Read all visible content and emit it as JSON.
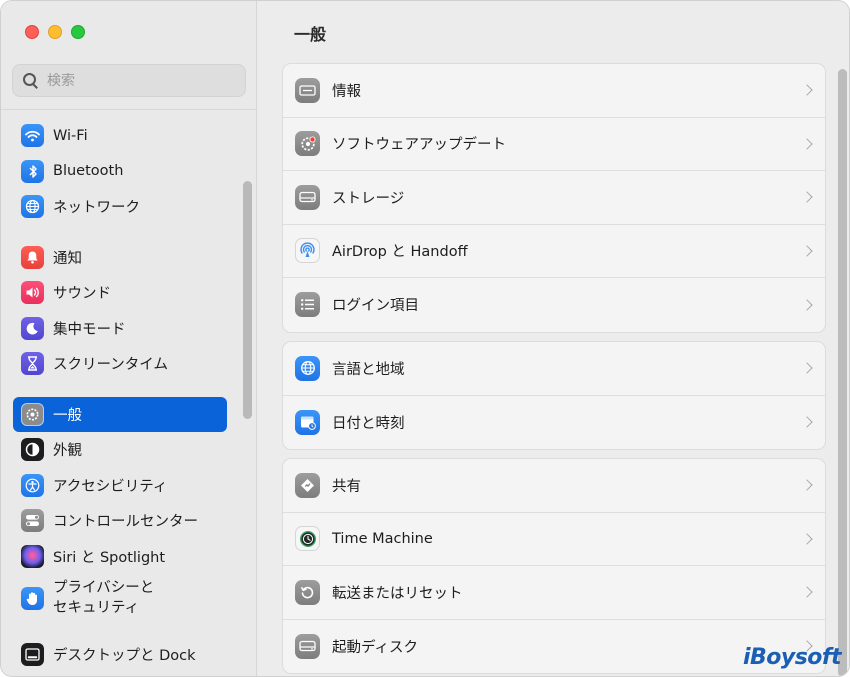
{
  "window": {
    "title": "一般"
  },
  "sidebar": {
    "search_placeholder": "検索",
    "items": [
      {
        "label": "Wi-Fi",
        "icon": "wifi-icon",
        "color": "#1f7cf0"
      },
      {
        "label": "Bluetooth",
        "icon": "bluetooth-icon",
        "color": "#1f7cf0"
      },
      {
        "label": "ネットワーク",
        "icon": "globe-icon",
        "color": "#1f7cf0"
      },
      {
        "label": "通知",
        "icon": "bell-icon",
        "color": "#f24a43"
      },
      {
        "label": "サウンド",
        "icon": "speaker-icon",
        "color": "#f0365f"
      },
      {
        "label": "集中モード",
        "icon": "moon-icon",
        "color": "#5a4fd9"
      },
      {
        "label": "スクリーンタイム",
        "icon": "hourglass-icon",
        "color": "#5a4fd9"
      },
      {
        "label": "一般",
        "icon": "gear-icon",
        "color": "#8c8c8c",
        "selected": true
      },
      {
        "label": "外観",
        "icon": "appearance-icon",
        "color": "#1d1d1f"
      },
      {
        "label": "アクセシビリティ",
        "icon": "accessibility-icon",
        "color": "#1f7cf0"
      },
      {
        "label": "コントロールセンター",
        "icon": "control-center-icon",
        "color": "#8c8c8c"
      },
      {
        "label": "Siri と Spotlight",
        "icon": "siri-icon",
        "color": "#6c5ff2"
      },
      {
        "label": "プライバシーと\nセキュリティ",
        "icon": "hand-icon",
        "color": "#1f7cf0"
      },
      {
        "label": "デスクトップと Dock",
        "icon": "dock-icon",
        "color": "#1d1d1f"
      }
    ]
  },
  "main": {
    "title": "一般",
    "groups": [
      [
        {
          "label": "情報",
          "icon": "info-icon"
        },
        {
          "label": "ソフトウェアアップデート",
          "icon": "software-update-icon"
        },
        {
          "label": "ストレージ",
          "icon": "storage-icon"
        },
        {
          "label": "AirDrop と Handoff",
          "icon": "airdrop-icon"
        },
        {
          "label": "ログイン項目",
          "icon": "login-items-icon"
        }
      ],
      [
        {
          "label": "言語と地域",
          "icon": "language-globe-icon"
        },
        {
          "label": "日付と時刻",
          "icon": "calendar-clock-icon"
        }
      ],
      [
        {
          "label": "共有",
          "icon": "sharing-icon"
        },
        {
          "label": "Time Machine",
          "icon": "time-machine-icon"
        },
        {
          "label": "転送またはリセット",
          "icon": "reset-icon"
        },
        {
          "label": "起動ディスク",
          "icon": "startup-disk-icon"
        }
      ]
    ]
  },
  "watermark": "iBoysoft",
  "colors": {
    "selection": "#0a63d9",
    "accent": "#1f7cf0"
  }
}
